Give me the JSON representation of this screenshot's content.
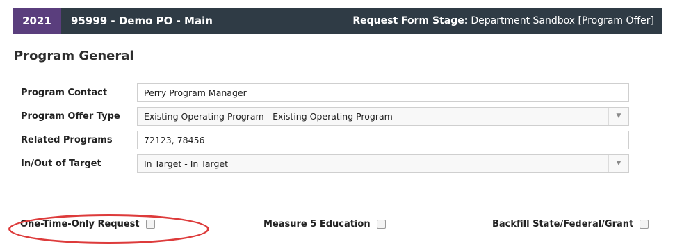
{
  "header": {
    "year": "2021",
    "program_title": "95999 - Demo PO - Main",
    "stage_label": "Request Form Stage:",
    "stage_value": "Department Sandbox [Program Offer]"
  },
  "section_title": "Program General",
  "fields": [
    {
      "label": "Program Contact",
      "value": "Perry Program Manager"
    },
    {
      "label": "Program Offer Type",
      "value": "Existing Operating Program - Existing Operating Program"
    },
    {
      "label": "Related Programs",
      "value": "72123, 78456"
    },
    {
      "label": "In/Out of Target",
      "value": "In Target - In Target"
    }
  ],
  "checkboxes": [
    {
      "label": "One-Time-Only Request",
      "checked": false
    },
    {
      "label": "Measure 5 Education",
      "checked": false
    },
    {
      "label": "Backfill State/Federal/Grant",
      "checked": false
    }
  ],
  "colors": {
    "header_bg": "#2f3b45",
    "year_bg": "#5a3e7d",
    "highlight": "#dd3b3b"
  }
}
